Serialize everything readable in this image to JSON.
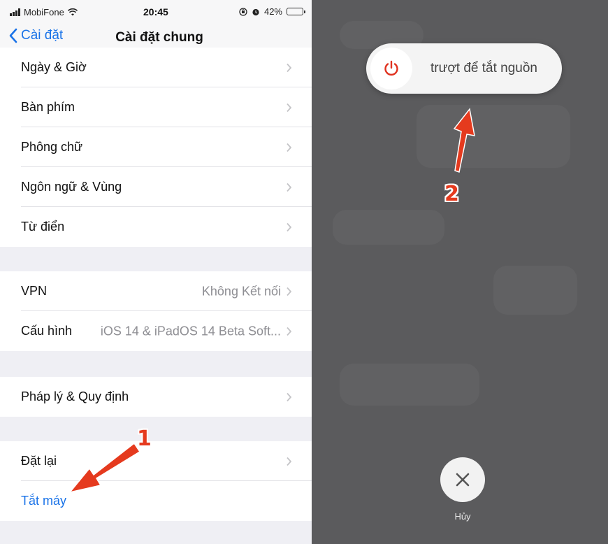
{
  "status_bar": {
    "carrier": "MobiFone",
    "time": "20:45",
    "battery": "42%",
    "battery_level": 0.42
  },
  "nav": {
    "back_label": "Cài đặt",
    "title": "Cài đặt chung"
  },
  "groups": [
    {
      "items": [
        {
          "label": "Ngày & Giờ"
        },
        {
          "label": "Bàn phím"
        },
        {
          "label": "Phông chữ"
        },
        {
          "label": "Ngôn ngữ & Vùng"
        },
        {
          "label": "Từ điển"
        }
      ]
    },
    {
      "items": [
        {
          "label": "VPN",
          "value": "Không Kết nối"
        },
        {
          "label": "Cấu hình",
          "value": "iOS 14 & iPadOS 14 Beta Soft..."
        }
      ]
    },
    {
      "items": [
        {
          "label": "Pháp lý & Quy định"
        }
      ]
    },
    {
      "items": [
        {
          "label": "Đặt lại"
        },
        {
          "label": "Tắt máy"
        }
      ]
    }
  ],
  "power_off": {
    "slider_text": "trượt để tắt nguồn",
    "cancel_label": "Hủy"
  },
  "annotations": {
    "step1": "1",
    "step2": "2"
  },
  "colors": {
    "accent_blue": "#1a73e8",
    "annotation_red": "#e53a1e",
    "overlay_gray": "#5b5b5d",
    "power_icon_red": "#e0321f"
  }
}
